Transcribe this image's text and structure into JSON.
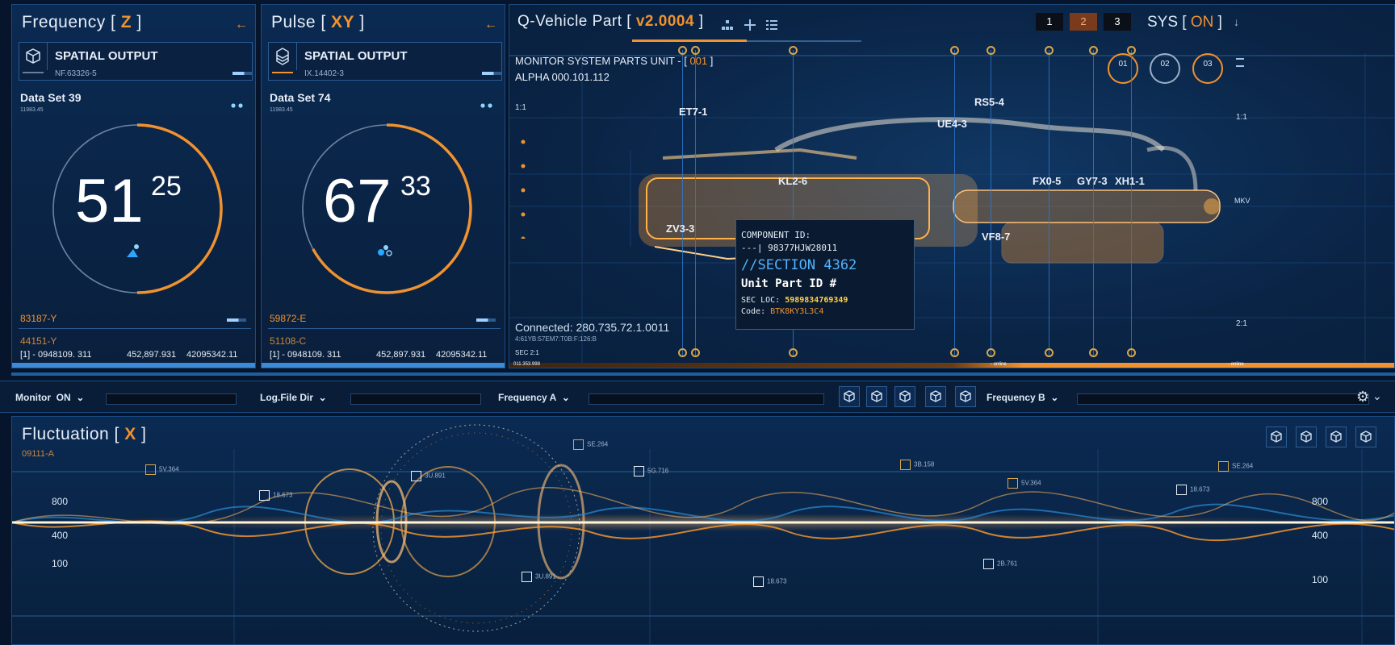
{
  "panels": {
    "frequency": {
      "title_prefix": "Frequency [ ",
      "title_hl": "Z",
      "title_suffix": " ]",
      "output_label": "SPATIAL OUTPUT",
      "output_id": "NF.63326-5",
      "dataset_label": "Data Set 39",
      "dataset_sub": "11983.45",
      "gauge_main": "51",
      "gauge_sup": "25",
      "gauge_fraction": 0.5,
      "code_a": "83187-Y",
      "code_b": "44151-Y",
      "readout_1": "[1] - 0948109. 311",
      "readout_2": "452,897.931",
      "readout_3": "42095342.11"
    },
    "pulse": {
      "title_prefix": "Pulse [ ",
      "title_hl": "XY",
      "title_suffix": " ]",
      "output_label": "SPATIAL OUTPUT",
      "output_id": "IX.14402-3",
      "dataset_label": "Data Set 74",
      "dataset_sub": "11983.45",
      "gauge_main": "67",
      "gauge_sup": "33",
      "gauge_fraction": 0.67,
      "code_a": "59872-E",
      "code_b": "51108-C",
      "readout_1": "[1] - 0948109. 311",
      "readout_2": "452,897.931",
      "readout_3": "42095342.11"
    }
  },
  "vehicle": {
    "title_prefix": "Q-Vehicle Part [ ",
    "title_hl": "v2.0004",
    "title_suffix": " ]",
    "tabs": [
      "1",
      "2",
      "3"
    ],
    "active_tab": "2",
    "sys_prefix": "SYS [ ",
    "sys_hl": "ON",
    "sys_suffix": " ]",
    "monitor_prefix": "MONITOR SYSTEM PARTS UNIT - [ ",
    "monitor_hl": "001",
    "monitor_suffix": " ]",
    "alpha": "ALPHA 000.101.112",
    "rings": [
      "01",
      "02",
      "03"
    ],
    "scale_left_top": "1:1",
    "scale_right_top": "1:1",
    "scale_right_bottom": "2:1",
    "sec_label": "SEC 2:1",
    "mkv": "MKV",
    "parts": [
      "ET7-1",
      "RS5-4",
      "UE4-3",
      "KL2-6",
      "FX0-5",
      "GY7-3",
      "XH1-1",
      "ZV3-3",
      "VF8-7"
    ],
    "connected": "Connected: 280.735.72.1.0011",
    "connected_sub": "4:61YB:57EM7:T0B:F:126:B",
    "status_left": "011.353.998",
    "status_online1": "- online",
    "status_online2": "- online",
    "tooltip": {
      "component_label": "COMPONENT ID:",
      "component_id": "---| 98377HJW28011",
      "section": "//SECTION 4362",
      "unit": "Unit Part ID #",
      "sec_loc_label": "SEC LOC: ",
      "sec_loc_val": "5989834769349",
      "code_label": "Code: ",
      "code_val": "BTK8KY3L3C4"
    }
  },
  "toolbar": {
    "monitor_label": "Monitor",
    "monitor_value": "ON",
    "logfile_label": "Log.File Dir",
    "freqA_label": "Frequency A",
    "freqB_label": "Frequency B"
  },
  "fluctuation": {
    "title_prefix": "Fluctuation [ ",
    "title_hl": "X",
    "title_suffix": " ]",
    "sub": "09111-A",
    "scale_left": [
      "800",
      "400",
      "100"
    ],
    "scale_right": [
      "800",
      "400",
      "100"
    ],
    "markers": [
      "5V.364",
      "18.673",
      "3U.891",
      "SE.264",
      "5G.716",
      "3B.158",
      "5V.364",
      "SE.264",
      "18.673",
      "3U.891",
      "18.673",
      "2B.761"
    ]
  },
  "colors": {
    "accent": "#f0922f",
    "panel": "#0b2a52",
    "border": "#1b4b80",
    "glow": "#ffb347"
  }
}
